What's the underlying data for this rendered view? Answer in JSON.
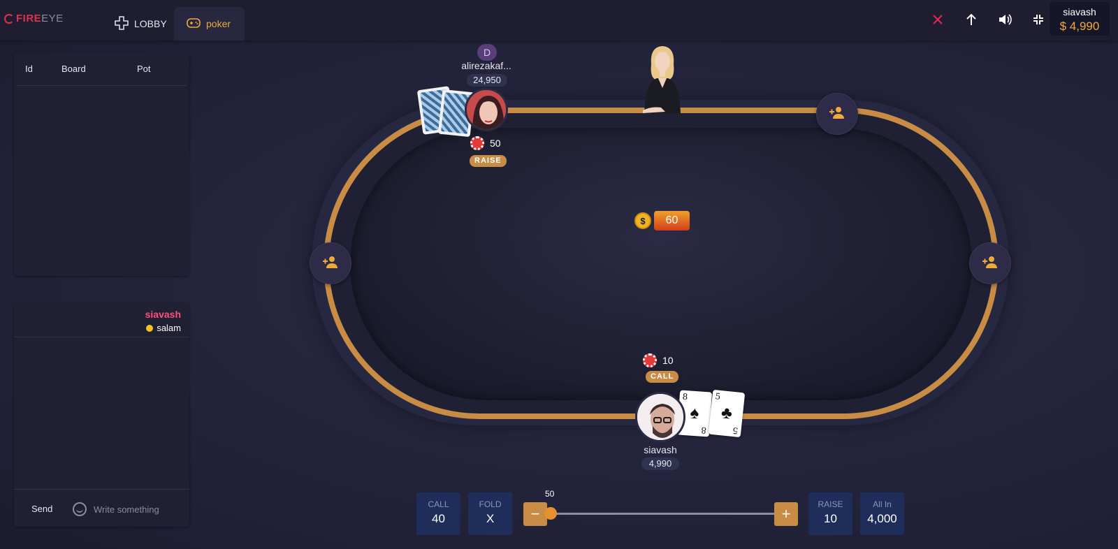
{
  "app": {
    "logo_fire": "FIRE",
    "logo_eye": "EYE"
  },
  "tabs": [
    {
      "label": "LOBBY",
      "icon": "gamepad-cross-icon",
      "active": false
    },
    {
      "label": "poker",
      "icon": "gamepad-icon",
      "active": true
    }
  ],
  "topbar": {
    "icons": [
      "close-icon",
      "arrow-up-icon",
      "volume-icon",
      "minimize-icon"
    ],
    "username": "siavash",
    "balance": "$ 4,990",
    "accent": "#f0a93a",
    "close_color": "#e8294f"
  },
  "history": {
    "columns": [
      "Id",
      "Board",
      "Pot"
    ],
    "rows": []
  },
  "chat": {
    "messages": [
      {
        "user": "siavash",
        "text": "salam"
      }
    ],
    "send_label": "Send",
    "input_placeholder": "Write something"
  },
  "table": {
    "pot": "60",
    "rim_color": "#c88c45"
  },
  "players": {
    "top": {
      "dealer_label": "D",
      "name": "alirezakaf...",
      "stack": "24,950",
      "bet": "50",
      "action": "RAISE"
    },
    "bottom": {
      "name": "siavash",
      "stack": "4,990",
      "bet": "10",
      "action": "CALL",
      "cards": [
        {
          "rank": "8",
          "suit": "♠"
        },
        {
          "rank": "5",
          "suit": "♣"
        }
      ]
    }
  },
  "controls": {
    "call": {
      "label": "CALL",
      "value": "40"
    },
    "fold": {
      "label": "FOLD",
      "value": "X"
    },
    "slider_value": "50",
    "minus": "−",
    "plus": "+",
    "raise": {
      "label": "RAISE",
      "value": "10"
    },
    "allin": {
      "label": "All In",
      "value": "4,000"
    }
  }
}
